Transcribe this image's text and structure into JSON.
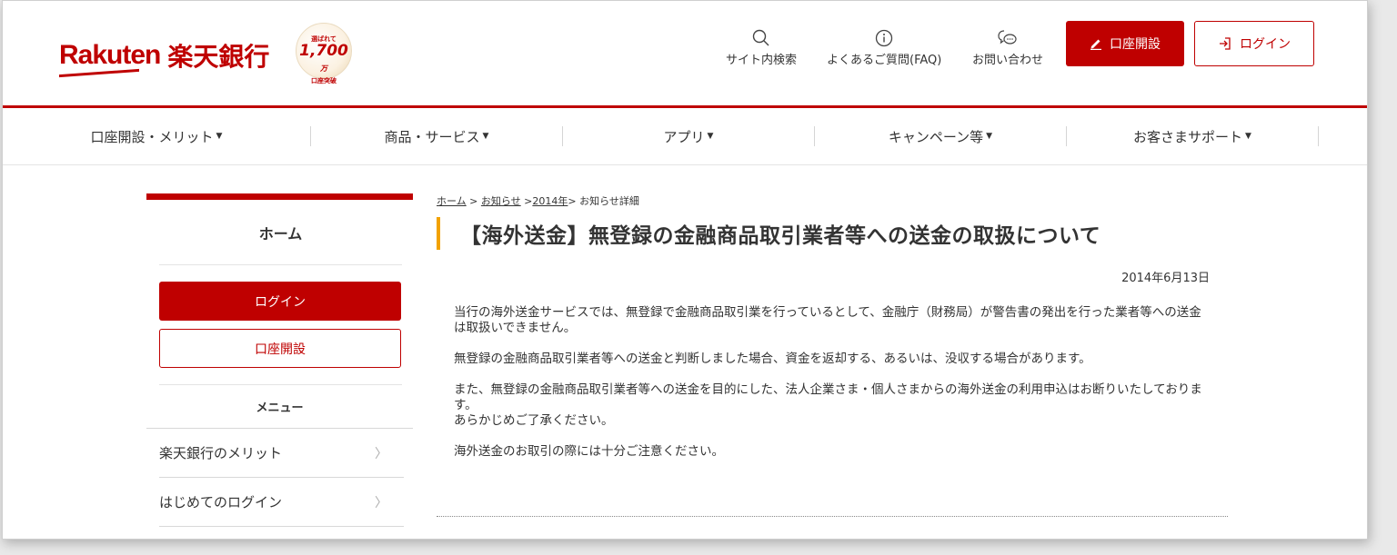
{
  "brand": {
    "logo_en": "Rakuten",
    "logo_ja": "楽天銀行",
    "badge_line1": "選ばれて",
    "badge_num": "1,700",
    "badge_unit": "万",
    "badge_line3": "口座突破",
    "accent_color": "#bf0000",
    "title_bar_color": "#f2a200"
  },
  "header": {
    "search_label": "サイト内検索",
    "faq_label": "よくあるご質問(FAQ)",
    "contact_label": "お問い合わせ",
    "open_account_label": "口座開設",
    "login_label": "ログイン"
  },
  "gnav": {
    "items": [
      {
        "label": "口座開設・メリット",
        "caret": "▼"
      },
      {
        "label": "商品・サービス",
        "caret": "▼"
      },
      {
        "label": "アプリ",
        "caret": "▼"
      },
      {
        "label": "キャンペーン等",
        "caret": "▼"
      },
      {
        "label": "お客さまサポート",
        "caret": "▼"
      }
    ]
  },
  "side": {
    "home_label": "ホーム",
    "login_label": "ログイン",
    "open_label": "口座開設",
    "menu_heading": "メニュー",
    "links": [
      {
        "label": "楽天銀行のメリット",
        "chevron": "〉"
      },
      {
        "label": "はじめてのログイン",
        "chevron": "〉"
      }
    ]
  },
  "main": {
    "breadcrumb": {
      "home": "ホーム",
      "sep1": " > ",
      "news": "お知らせ",
      "sep2": " >",
      "year": "2014年",
      "sep3": "> ",
      "current": "お知らせ詳細"
    },
    "title": "【海外送金】無登録の金融商品取引業者等への送金の取扱について",
    "date": "2014年6月13日",
    "paragraphs": [
      "当行の海外送金サービスでは、無登録で金融商品取引業を行っているとして、金融庁（財務局）が警告書の発出を行った業者等への送金は取扱いできません。",
      "無登録の金融商品取引業者等への送金と判断しました場合、資金を返却する、あるいは、没収する場合があります。",
      "また、無登録の金融商品取引業者等への送金を目的にした、法人企業さま・個人さまからの海外送金の利用申込はお断りいたしております。",
      "あらかじめご了承ください。",
      "海外送金のお取引の際には十分ご注意ください。"
    ]
  }
}
